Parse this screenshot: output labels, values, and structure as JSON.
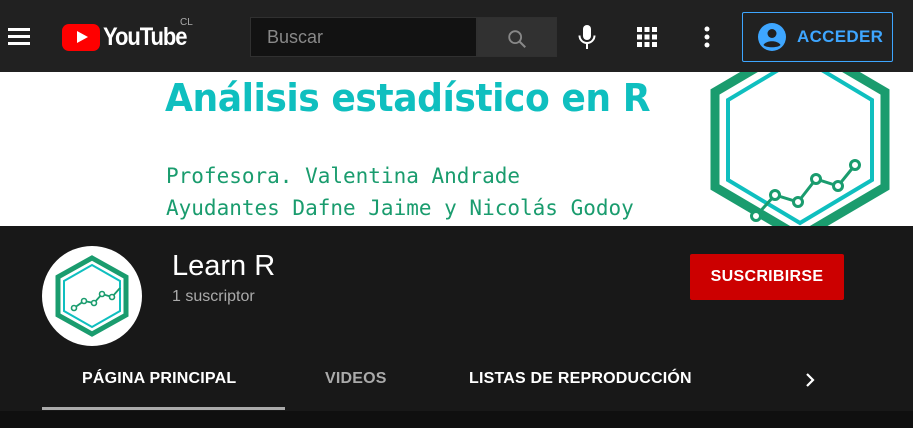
{
  "header": {
    "logo_text": "YouTube",
    "country_code": "CL",
    "search": {
      "placeholder": "Buscar",
      "value": ""
    },
    "signin_label": "ACCEDER",
    "icons": [
      "menu-icon",
      "search-icon",
      "microphone-icon",
      "apps-grid-icon",
      "more-vert-icon",
      "account-circle-icon"
    ]
  },
  "banner": {
    "title": "Análisis estadístico en R",
    "line1": "Profesora. Valentina Andrade",
    "line2": "Ayudantes Dafne Jaime y Nicolás Godoy"
  },
  "channel": {
    "name": "Learn R",
    "subscribers": "1 suscriptor",
    "subscribe_label": "SUSCRIBIRSE"
  },
  "tabs": [
    {
      "label": "PÁGINA PRINCIPAL",
      "selected": true
    },
    {
      "label": "VIDEOS",
      "selected": false
    },
    {
      "label": "LISTAS DE REPRODUCCIÓN",
      "selected": false
    }
  ],
  "colors": {
    "accent_blue": "#3ea6ff",
    "subscribe_red": "#cc0000",
    "brand_teal": "#0fbfbf",
    "brand_green": "#1a9c6e"
  }
}
